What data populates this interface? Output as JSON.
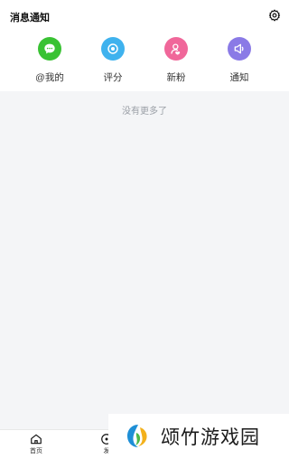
{
  "header": {
    "title": "消息通知"
  },
  "categories": [
    {
      "label": "@我的",
      "icon": "chat-bubble-icon",
      "color": "#39c233"
    },
    {
      "label": "评分",
      "icon": "rating-target-icon",
      "color": "#3fb2ee"
    },
    {
      "label": "新粉",
      "icon": "new-fans-icon",
      "color": "#f0679a"
    },
    {
      "label": "通知",
      "icon": "megaphone-icon",
      "color": "#8a7ae6"
    }
  ],
  "empty_message": "没有更多了",
  "tabbar": {
    "home_label": "首页",
    "discover_label": "发"
  },
  "watermark": {
    "text": "颂竹游戏园"
  }
}
